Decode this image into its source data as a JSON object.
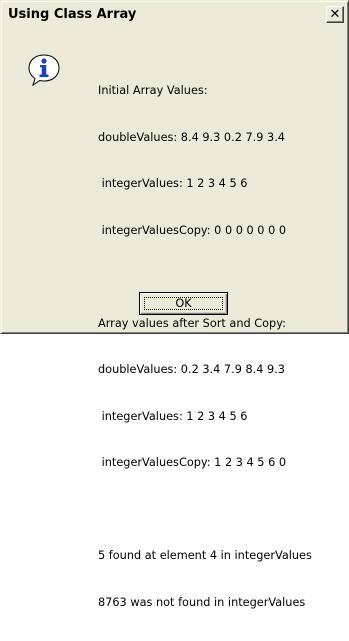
{
  "window": {
    "title": "Using Class Array",
    "close_label": "✕"
  },
  "icon": {
    "name": "info-icon",
    "color": "#1a3fcf"
  },
  "message": {
    "heading1": "Initial Array Values:",
    "init_double": "doubleValues: 8.4 9.3 0.2 7.9 3.4",
    "init_integer": " integerValues: 1 2 3 4 5 6",
    "init_integer_copy": " integerValuesCopy: 0 0 0 0 0 0 0",
    "heading2": "Array values after Sort and Copy:",
    "after_double": "doubleValues: 0.2 3.4 7.9 8.4 9.3",
    "after_integer": " integerValues: 1 2 3 4 5 6",
    "after_integer_copy": " integerValuesCopy: 1 2 3 4 5 6 0",
    "found_line": "5 found at element 4 in integerValues",
    "not_found_line": "8763 was not found in integerValues"
  },
  "buttons": {
    "ok_label": "OK"
  }
}
